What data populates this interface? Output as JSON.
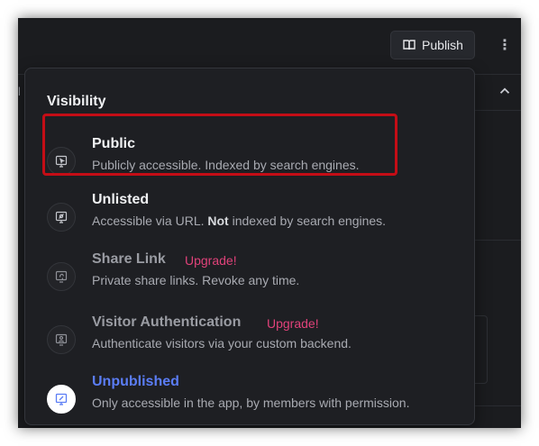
{
  "header": {
    "publish_label": "Publish",
    "publish_icon": "book-open-icon",
    "more_icon": "kebab-icon",
    "more_glyph": "⋮",
    "partial_text": "l"
  },
  "visibility": {
    "title": "Visibility",
    "options": [
      {
        "label": "Public",
        "description": "Publicly accessible. Indexed by search engines.",
        "icon": "public-icon",
        "selected": true
      },
      {
        "label": "Unlisted",
        "description_before": "Accessible via URL. ",
        "description_bold": "Not",
        "description_after": " indexed by search engines.",
        "icon": "unlisted-icon"
      },
      {
        "label": "Share Link",
        "badge": "Upgrade!",
        "description": "Private share links. Revoke any time.",
        "icon": "share-link-icon"
      },
      {
        "label": "Visitor Authentication",
        "badge": "Upgrade!",
        "description": "Authenticate visitors via your custom backend.",
        "icon": "visitor-auth-icon"
      },
      {
        "label": "Unpublished",
        "description": "Only accessible in the app, by members with permission.",
        "icon": "unpublished-icon"
      }
    ]
  },
  "colors": {
    "background": "#1b1c1f",
    "popover": "#1e1f23",
    "accent": "#5b7df5",
    "upgrade": "#e0427a",
    "highlight": "#c40d16"
  }
}
